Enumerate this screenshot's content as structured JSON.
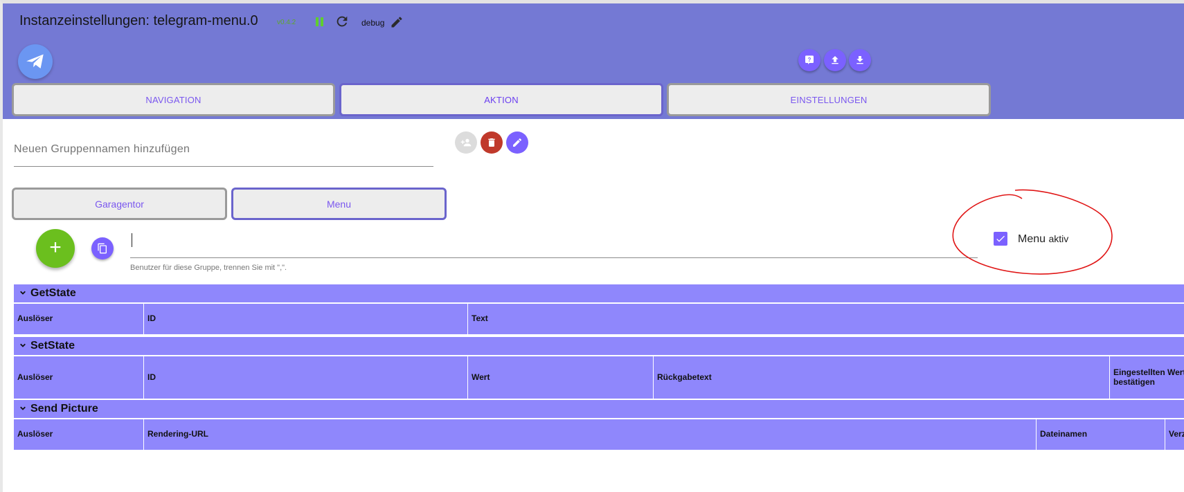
{
  "header": {
    "title": "Instanzeinstellungen: telegram-menu.0",
    "version": "v0.4.2",
    "log_level": "debug",
    "icons": [
      "telegram-logo-icon",
      "help-icon",
      "upload-icon",
      "download-icon"
    ]
  },
  "tabs": [
    {
      "label": "NAVIGATION",
      "active": false
    },
    {
      "label": "AKTION",
      "active": true
    },
    {
      "label": "EINSTELLUNGEN",
      "active": false
    }
  ],
  "group": {
    "placeholder": "Neuen Gruppennamen hinzufügen",
    "subtabs": [
      {
        "label": "Garagentor",
        "active": false
      },
      {
        "label": "Menu",
        "active": true
      }
    ]
  },
  "users": {
    "value": "",
    "helper": "Benutzer für diese Gruppe, trennen Sie mit \",\"."
  },
  "menu_active": {
    "label": "Menu",
    "label_suffix": "aktiv",
    "checked": true
  },
  "sections": {
    "getstate": {
      "title": "GetState",
      "columns": [
        "Auslöser",
        "ID",
        "Text"
      ]
    },
    "setstate": {
      "title": "SetState",
      "columns": [
        "Auslöser",
        "ID",
        "Wert",
        "Rückgabetext",
        "Eingestellten Wert bestätigen"
      ]
    },
    "sendpicture": {
      "title": "Send Picture",
      "columns": [
        "Auslöser",
        "Rendering-URL",
        "Dateinamen",
        "Verzögerung"
      ]
    }
  },
  "colors": {
    "header_bg": "#7479d4",
    "accent": "#7b61ff",
    "section_bg": "#8f87fc",
    "add_green": "#6bbf1e",
    "delete_red": "#c0392b",
    "annotation_red": "#e01515"
  }
}
